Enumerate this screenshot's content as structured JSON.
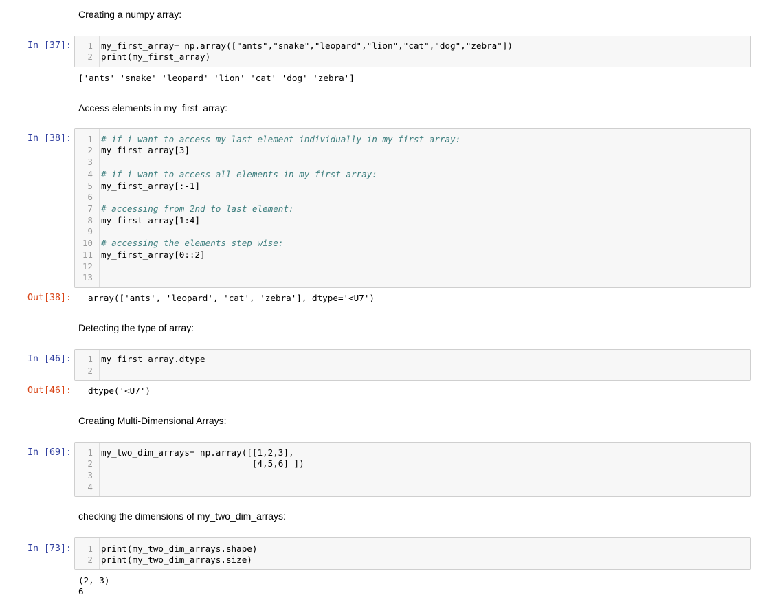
{
  "cells": [
    {
      "type": "markdown",
      "text": "Creating a numpy array:"
    },
    {
      "type": "code",
      "prompt": "In [37]:",
      "lines": [
        "my_first_array= np.array([\"ants\",\"snake\",\"leopard\",\"lion\",\"cat\",\"dog\",\"zebra\"])",
        "print(my_first_array)"
      ],
      "output_stream": [
        "['ants' 'snake' 'leopard' 'lion' 'cat' 'dog' 'zebra']"
      ]
    },
    {
      "type": "markdown",
      "text": "Access elements in my_first_array:"
    },
    {
      "type": "code",
      "prompt": "In [38]:",
      "lines": [
        "# if i want to access my last element individually in my_first_array:",
        "my_first_array[3]",
        "",
        "# if i want to access all elements in my_first_array:",
        "my_first_array[:-1]",
        "",
        "# accessing from 2nd to last element:",
        "my_first_array[1:4]",
        "",
        "# accessing the elements step wise:",
        "my_first_array[0::2]",
        "",
        ""
      ],
      "out_prompt": "Out[38]:",
      "out_value": "array(['ants', 'leopard', 'cat', 'zebra'], dtype='<U7')"
    },
    {
      "type": "markdown",
      "text": "Detecting the type of array:"
    },
    {
      "type": "code",
      "prompt": "In [46]:",
      "lines": [
        "my_first_array.dtype",
        ""
      ],
      "out_prompt": "Out[46]:",
      "out_value": "dtype('<U7')"
    },
    {
      "type": "markdown",
      "text": "Creating Multi-Dimensional Arrays:"
    },
    {
      "type": "code",
      "prompt": "In [69]:",
      "lines": [
        "my_two_dim_arrays= np.array([[1,2,3],",
        "                             [4,5,6] ])",
        "",
        ""
      ]
    },
    {
      "type": "markdown",
      "text": "checking the dimensions of my_two_dim_arrays:"
    },
    {
      "type": "code",
      "prompt": "In [73]:",
      "lines": [
        "print(my_two_dim_arrays.shape)",
        "print(my_two_dim_arrays.size)"
      ],
      "output_stream": [
        "(2, 3)",
        "6"
      ]
    }
  ],
  "colors": {
    "in_prompt": "#303f9f",
    "out_prompt": "#d84315",
    "string": "#ba2121",
    "comment": "#408080",
    "builtin": "#008000",
    "operator": "#aa22ff",
    "cell_bg": "#f7f7f7"
  }
}
